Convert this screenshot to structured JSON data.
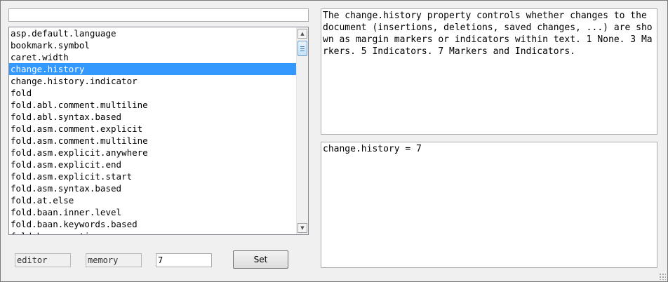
{
  "search": {
    "value": ""
  },
  "properties": {
    "items": [
      "asp.default.language",
      "bookmark.symbol",
      "caret.width",
      "change.history",
      "change.history.indicator",
      "fold",
      "fold.abl.comment.multiline",
      "fold.abl.syntax.based",
      "fold.asm.comment.explicit",
      "fold.asm.comment.multiline",
      "fold.asm.explicit.anywhere",
      "fold.asm.explicit.end",
      "fold.asm.explicit.start",
      "fold.asm.syntax.based",
      "fold.at.else",
      "fold.baan.inner.level",
      "fold.baan.keywords.based",
      "fold.baan.sections"
    ],
    "selected_index": 3
  },
  "description": {
    "text": "The change.history property controls whether changes to the document (insertions, deletions, saved changes, ...) are shown as margin markers or indicators within text. 1 None. 3 Markers. 5 Indicators. 7 Markers and Indicators."
  },
  "editor_output": {
    "text": "change.history = 7"
  },
  "bottom_bar": {
    "scope": "editor",
    "kind": "memory",
    "value": "7",
    "set_label": "Set"
  },
  "colors": {
    "selection": "#3399ff",
    "window_bg": "#f0f0f0"
  }
}
